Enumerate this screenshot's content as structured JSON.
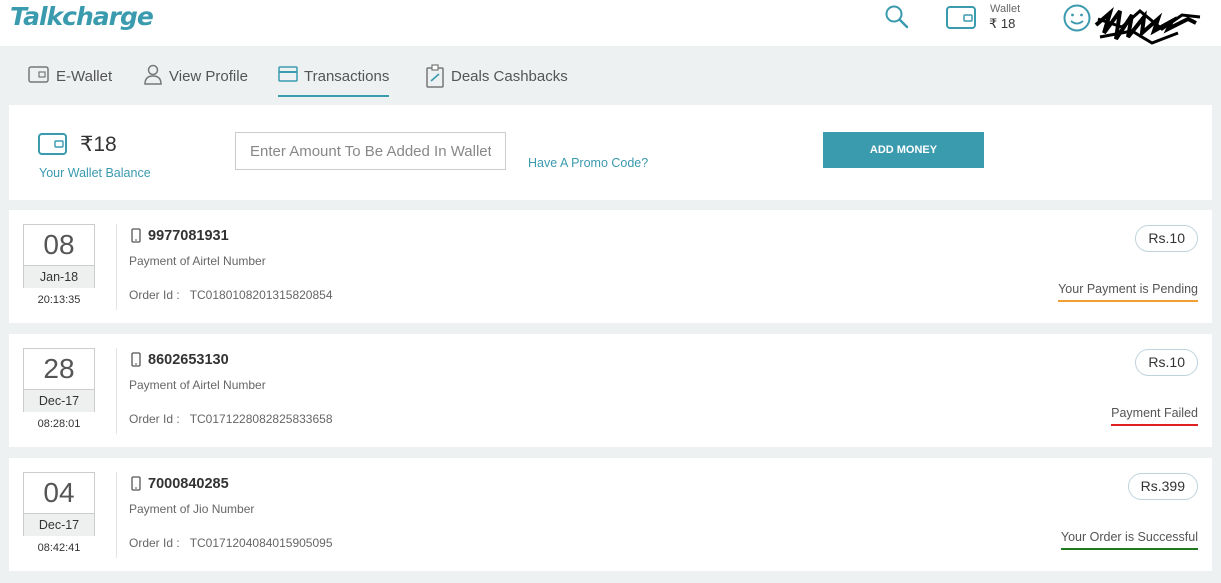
{
  "header": {
    "logo": "Talkcharge",
    "wallet_label": "Wallet",
    "wallet_amount": "₹ 18",
    "icons": [
      "search-icon",
      "wallet-icon",
      "smiley-avatar-icon"
    ]
  },
  "tabs": [
    {
      "label": "E-Wallet",
      "icon": "wallet-icon"
    },
    {
      "label": "View Profile",
      "icon": "profile-icon"
    },
    {
      "label": "Transactions",
      "icon": "card-icon",
      "active": true
    },
    {
      "label": "Deals Cashbacks",
      "icon": "coupon-icon"
    }
  ],
  "wallet": {
    "balance": "₹18",
    "balance_label": "Your Wallet Balance",
    "input_placeholder": "Enter Amount To Be Added In Wallet",
    "promo_link": "Have A Promo Code?",
    "add_button": "ADD MONEY"
  },
  "transactions": [
    {
      "day": "08",
      "month": "Jan-18",
      "time": "20:13:35",
      "number": "9977081931",
      "desc": "Payment of Airtel Number",
      "order_label": "Order Id :",
      "order_id": "TC0180108201315820854",
      "amount": "Rs.10",
      "status": "Your Payment is Pending",
      "status_color": "#f0a032"
    },
    {
      "day": "28",
      "month": "Dec-17",
      "time": "08:28:01",
      "number": "8602653130",
      "desc": "Payment of Airtel Number",
      "order_label": "Order Id :",
      "order_id": "TC0171228082825833658",
      "amount": "Rs.10",
      "status": "Payment Failed",
      "status_color": "#e02020"
    },
    {
      "day": "04",
      "month": "Dec-17",
      "time": "08:42:41",
      "number": "7000840285",
      "desc": "Payment of Jio Number",
      "order_label": "Order Id :",
      "order_id": "TC0171204084015905095",
      "amount": "Rs.399",
      "status": "Your Order is Successful",
      "status_color": "#1f7a1f"
    }
  ],
  "colors": {
    "accent": "#3a9aae",
    "background": "#edf1f2"
  }
}
